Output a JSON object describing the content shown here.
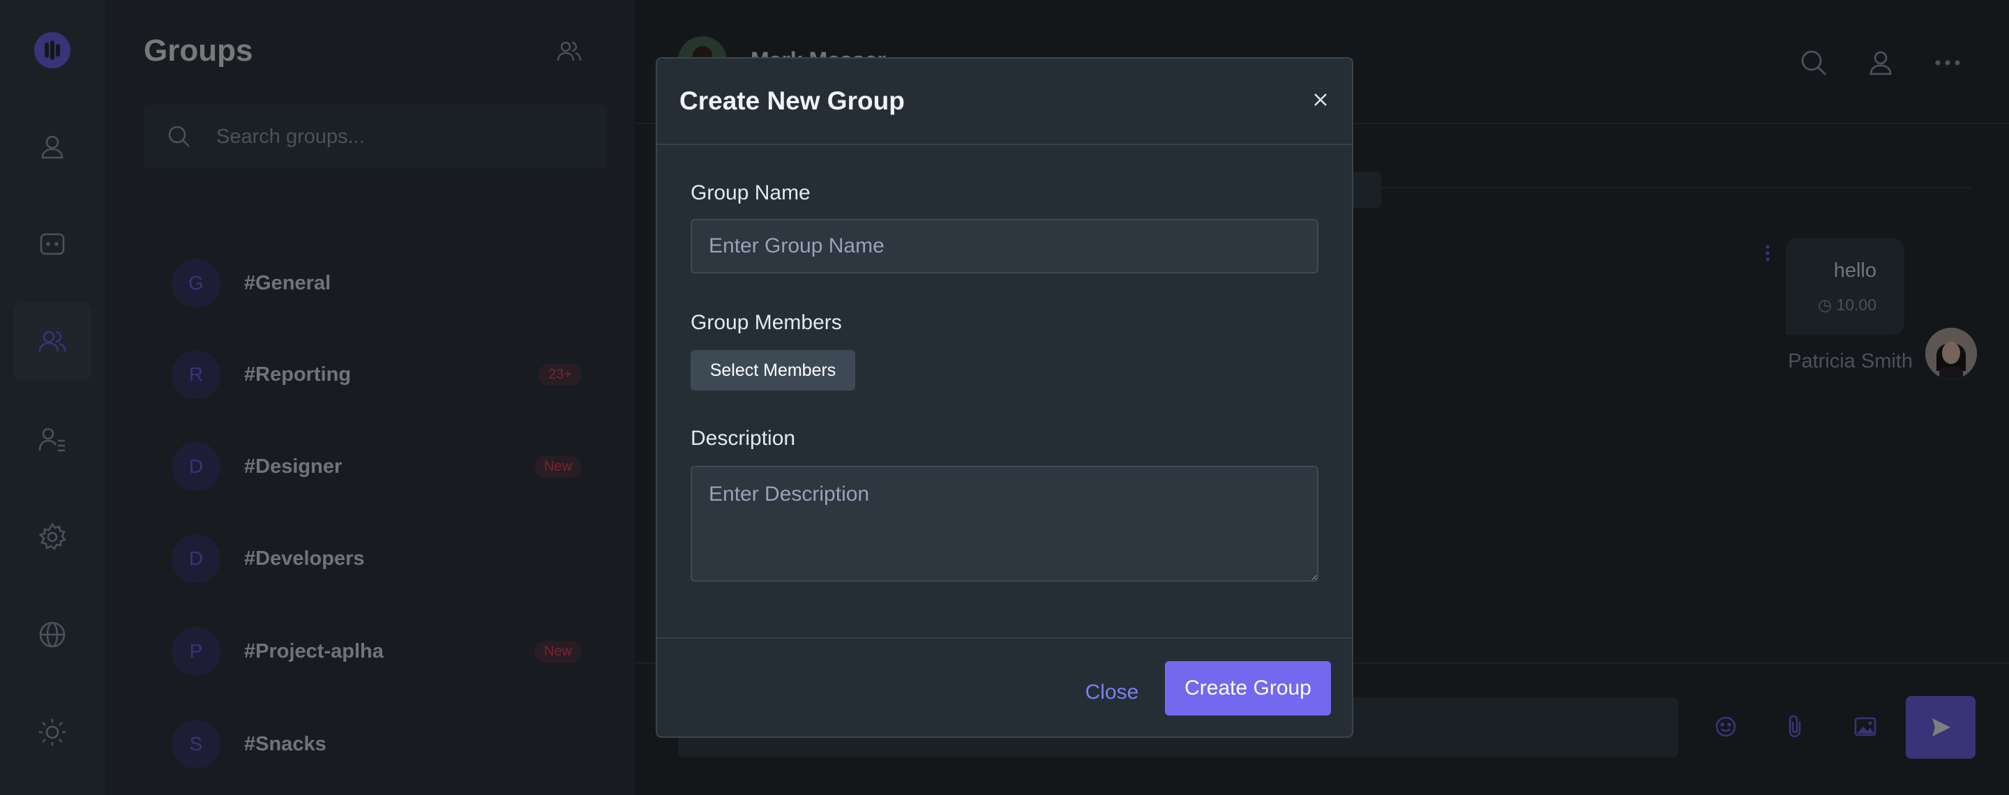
{
  "sidebar": {
    "logo_icon": "chat-logo-icon",
    "items": [
      {
        "name": "profile",
        "icon": "user-icon"
      },
      {
        "name": "chats",
        "icon": "message-square-icon"
      },
      {
        "name": "groups",
        "icon": "users-icon",
        "active": true
      },
      {
        "name": "contacts",
        "icon": "contacts-icon"
      },
      {
        "name": "settings",
        "icon": "gear-icon"
      },
      {
        "name": "language",
        "icon": "globe-icon"
      },
      {
        "name": "theme",
        "icon": "sun-icon"
      }
    ]
  },
  "groups": {
    "title": "Groups",
    "search_placeholder": "Search groups...",
    "items": [
      {
        "initial": "G",
        "name": "#General",
        "badge": ""
      },
      {
        "initial": "R",
        "name": "#Reporting",
        "badge": "23+"
      },
      {
        "initial": "D",
        "name": "#Designer",
        "badge": "New"
      },
      {
        "initial": "D",
        "name": "#Developers",
        "badge": ""
      },
      {
        "initial": "P",
        "name": "#Project-aplha",
        "badge": "New"
      },
      {
        "initial": "S",
        "name": "#Snacks",
        "badge": ""
      }
    ]
  },
  "chat": {
    "contact_name": "Mark Messer",
    "message": {
      "text": "hello",
      "time": "10.00",
      "author": "Patricia Smith"
    }
  },
  "modal": {
    "title": "Create New Group",
    "group_name_label": "Group Name",
    "group_name_placeholder": "Enter Group Name",
    "members_label": "Group Members",
    "select_members_label": "Select Members",
    "description_label": "Description",
    "description_placeholder": "Enter Description",
    "close_label": "Close",
    "create_label": "Create Group"
  },
  "colors": {
    "accent": "#7269ef",
    "badge": "#ef476f",
    "background": "#262e35"
  }
}
